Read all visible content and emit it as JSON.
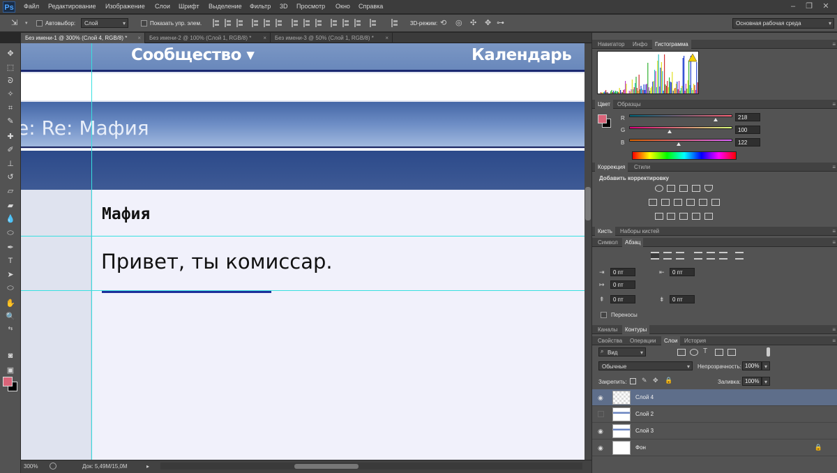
{
  "app": {
    "logo": "Ps"
  },
  "menu": [
    "Файл",
    "Редактирование",
    "Изображение",
    "Слои",
    "Шрифт",
    "Выделение",
    "Фильтр",
    "3D",
    "Просмотр",
    "Окно",
    "Справка"
  ],
  "options": {
    "autoselect_label": "Автовыбор:",
    "autoselect_value": "Слой",
    "show_controls_label": "Показать упр. элем.",
    "mode3d_label": "3D-режим:",
    "workspace": "Основная рабочая среда"
  },
  "tabs": [
    {
      "label": "Без имени-1 @ 300% (Слой 4, RGB/8) *",
      "close": "×"
    },
    {
      "label": "Без имени-2 @ 100% (Слой 1, RGB/8) *",
      "close": "×"
    },
    {
      "label": "Без имени-3 @ 50% (Слой 1, RGB/8) *",
      "close": "×"
    }
  ],
  "document": {
    "nav_community": "Сообщество ▾",
    "nav_calendar": "Календарь",
    "topic_title": "e: Re: Мафия",
    "post_title": "Мафия",
    "post_body": "Привет, ты комиссар."
  },
  "status": {
    "zoom": "300%",
    "doc_info": "Док: 5,49М/15,0М"
  },
  "panels": {
    "histogram_tabs": [
      "Навигатор",
      "Инфо",
      "Гистограмма"
    ],
    "color_tabs": [
      "Цвет",
      "Образцы"
    ],
    "rgb": [
      {
        "channel": "R",
        "value": "218"
      },
      {
        "channel": "G",
        "value": "100"
      },
      {
        "channel": "B",
        "value": "122"
      }
    ],
    "adjust_tabs": [
      "Коррекция",
      "Стили"
    ],
    "adjust_title": "Добавить корректировку",
    "brush_tabs": [
      "Кисть",
      "Наборы кистей"
    ],
    "char_tabs": [
      "Символ",
      "Абзац"
    ],
    "para_values": [
      "0 пт",
      "0 пт",
      "0 пт",
      "0 пт",
      "0 пт"
    ],
    "hyphenation": "Переносы",
    "channels_tabs": [
      "Каналы",
      "Контуры"
    ],
    "layers_tabs": [
      "Свойства",
      "Операции",
      "Слои",
      "История"
    ],
    "filter_kind": "Вид",
    "blend_mode": "Обычные",
    "opacity_label": "Непрозрачность:",
    "opacity_value": "100%",
    "lock_label": "Закрепить:",
    "fill_label": "Заливка:",
    "fill_value": "100%",
    "layers": [
      {
        "name": "Слой 4",
        "visible": true
      },
      {
        "name": "Слой 2",
        "visible": false
      },
      {
        "name": "Слой 3",
        "visible": true
      },
      {
        "name": "Фон",
        "visible": true
      }
    ]
  },
  "colors": {
    "foreground": "#da6479",
    "background": "#000000",
    "guide": "#37e0e0"
  }
}
